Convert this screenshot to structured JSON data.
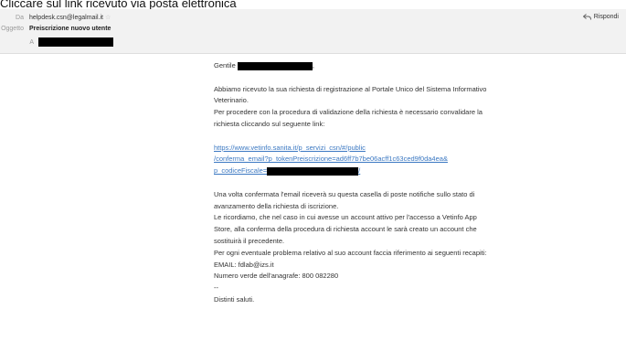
{
  "caption": "Cliccare sul link ricevuto via posta elettronica",
  "header": {
    "from_label": "Da",
    "from_value": "helpdesk.csn@legalmail.it",
    "subject_label": "Oggetto",
    "subject_value": "Preiscrizione nuovo utente",
    "to_label": "A",
    "reply_label": "Rispondi"
  },
  "body": {
    "greeting_prefix": "Gentile",
    "greeting_suffix": ",",
    "para1_line1": "Abbiamo ricevuto la sua richiesta di registrazione al Portale Unico del Sistema Informativo",
    "para1_line2": "Veterinario.",
    "para2_line1": "Per procedere con la procedura di validazione della richiesta è necessario convalidare la",
    "para2_line2": "richiesta cliccando sul seguente link:",
    "link_line1": "https://www.vetinfo.sanita.it/p_servizi_csn/#/public",
    "link_line2": "/conferma_email?p_tokenPreiscrizione=ad6ff7b7be06acff1c63ced9f0da4ea&",
    "link_line3_prefix": "p_codiceFiscale=",
    "link_line3_suffix": "/",
    "para3_line1": "Una volta confermata l'email riceverà su questa casella di poste notifiche sullo stato di",
    "para3_line2": "avanzamento della richiesta di iscrizione.",
    "para4_line1": "Le ricordiamo, che nel caso in cui avesse un account attivo per l'accesso a Vetinfo App",
    "para4_line2": "Store, alla conferma della procedura di richiesta account le sarà creato un account che",
    "para4_line3": "sostituirà il precedente.",
    "para5_line1": "Per ogni eventuale problema relativo al suo account faccia riferimento ai seguenti recapiti:",
    "para5_line2": "EMAIL: fdlab@izs.it",
    "para5_line3": "Numero verde dell'anagrafe: 800 082280",
    "separator": "--",
    "closing": "Distinti saluti."
  },
  "colors": {
    "header_bg": "#f2f2f2",
    "link": "#3b78c2",
    "redaction": "#000000"
  },
  "icons": {
    "reply": "reply-arrow-icon",
    "star": "star-icon"
  }
}
